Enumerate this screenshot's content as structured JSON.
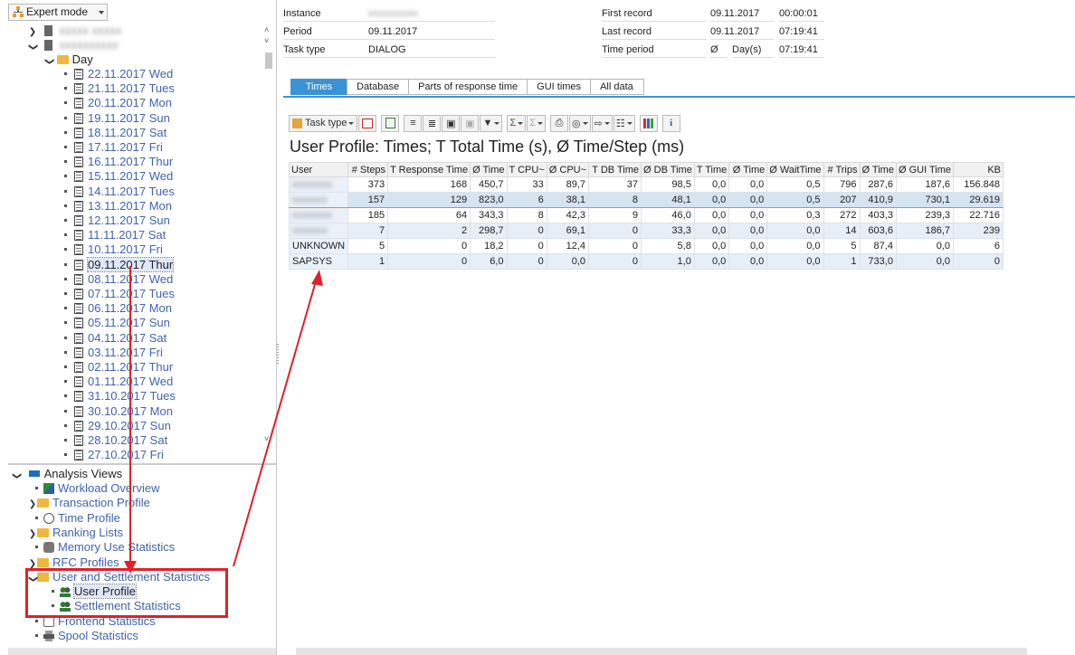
{
  "left": {
    "expert_mode_label": "Expert mode",
    "tree_day_label": "Day",
    "dates": [
      "22.11.2017 Wed",
      "21.11.2017 Tues",
      "20.11.2017 Mon",
      "19.11.2017 Sun",
      "18.11.2017 Sat",
      "17.11.2017 Fri",
      "16.11.2017 Thur",
      "15.11.2017 Wed",
      "14.11.2017 Tues",
      "13.11.2017 Mon",
      "12.11.2017 Sun",
      "11.11.2017 Sat",
      "10.11.2017 Fri",
      "09.11.2017 Thur",
      "08.11.2017 Wed",
      "07.11.2017 Tues",
      "06.11.2017 Mon",
      "05.11.2017 Sun",
      "04.11.2017 Sat",
      "03.11.2017 Fri",
      "02.11.2017 Thur",
      "01.11.2017 Wed",
      "31.10.2017 Tues",
      "30.10.2017 Mon",
      "29.10.2017 Sun",
      "28.10.2017 Sat",
      "27.10.2017 Fri"
    ],
    "selected_date_index": 13,
    "analysis_views_label": "Analysis Views",
    "analysis_items": [
      "Workload Overview",
      "Transaction Profile",
      "Time Profile",
      "Ranking Lists",
      "Memory Use Statistics",
      "RFC Profiles",
      "User and Settlement Statistics",
      "User Profile",
      "Settlement Statistics",
      "Frontend Statistics",
      "Spool Statistics"
    ]
  },
  "header": {
    "instance_label": "Instance",
    "period_label": "Period",
    "period_value": "09.11.2017",
    "task_type_label": "Task type",
    "task_type_value": "DIALOG",
    "first_record_label": "First record",
    "first_record_date": "09.11.2017",
    "first_record_time": "00:00:01",
    "last_record_label": "Last record",
    "last_record_date": "09.11.2017",
    "last_record_time": "07:19:41",
    "time_period_label": "Time period",
    "time_period_sym": "Ø",
    "time_period_unit": "Day(s)",
    "time_period_value": "07:19:41"
  },
  "tabs": [
    "Times",
    "Database",
    "Parts of response time",
    "GUI times",
    "All data"
  ],
  "toolbar": {
    "task_type_label": "Task type"
  },
  "grid": {
    "title": "User Profile: Times; T Total Time (s), Ø Time/Step (ms)",
    "columns": [
      "User",
      "# Steps",
      "T Response Time",
      "Ø Time",
      "T CPU~",
      "Ø CPU~",
      "T DB Time",
      "Ø DB Time",
      "T Time",
      "Ø Time",
      "Ø WaitTime",
      "# Trips",
      "Ø Time",
      "Ø GUI Time",
      "KB"
    ],
    "rows": [
      [
        "xxxxxxxx",
        "373",
        "168",
        "450,7",
        "33",
        "89,7",
        "37",
        "98,5",
        "0,0",
        "0,0",
        "0,5",
        "796",
        "287,6",
        "187,6",
        "156.848"
      ],
      [
        "xxxxxxx",
        "157",
        "129",
        "823,0",
        "6",
        "38,1",
        "8",
        "48,1",
        "0,0",
        "0,0",
        "0,5",
        "207",
        "410,9",
        "730,1",
        "29.619"
      ],
      [
        "xxxxxxxx",
        "185",
        "64",
        "343,3",
        "8",
        "42,3",
        "9",
        "46,0",
        "0,0",
        "0,0",
        "0,3",
        "272",
        "403,3",
        "239,3",
        "22.716"
      ],
      [
        "xxxxxxx",
        "7",
        "2",
        "298,7",
        "0",
        "69,1",
        "0",
        "33,3",
        "0,0",
        "0,0",
        "0,0",
        "14",
        "603,6",
        "186,7",
        "239"
      ],
      [
        "UNKNOWN",
        "5",
        "0",
        "18,2",
        "0",
        "12,4",
        "0",
        "5,8",
        "0,0",
        "0,0",
        "0,0",
        "5",
        "87,4",
        "0,0",
        "6"
      ],
      [
        "SAPSYS",
        "1",
        "0",
        "6,0",
        "0",
        "0,0",
        "0",
        "1,0",
        "0,0",
        "0,0",
        "0,0",
        "1",
        "733,0",
        "0,0",
        "0"
      ]
    ]
  },
  "colors": {
    "accent": "#3a93d6",
    "link": "#3f63b0",
    "highlight_box": "#e0202a",
    "selection_border": "#f08a1e"
  }
}
